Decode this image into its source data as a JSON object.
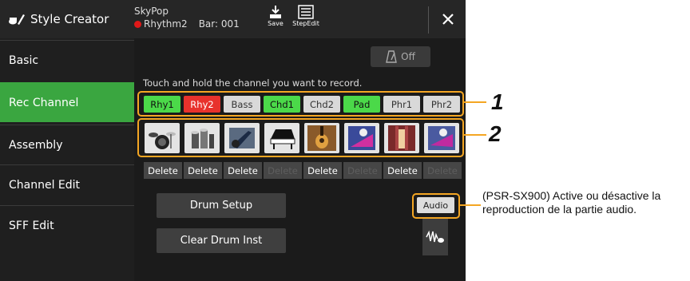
{
  "header": {
    "app_title": "Style Creator",
    "song_name": "SkyPop",
    "rec_channel": "Rhythm2",
    "bar_readout": "Bar: 001",
    "save_label": "Save",
    "stepedit_label": "StepEdit"
  },
  "sidebar": {
    "items": [
      {
        "label": "Basic",
        "active": false
      },
      {
        "label": "Rec Channel",
        "active": true
      },
      {
        "label": "Assembly",
        "active": false
      },
      {
        "label": "Channel Edit",
        "active": false
      },
      {
        "label": "SFF Edit",
        "active": false
      }
    ]
  },
  "main": {
    "metronome_label": "Off",
    "instruction": "Touch and hold the channel you want to record.",
    "channels": [
      {
        "label": "Rhy1",
        "state": "on",
        "icon": "drum-kit-icon",
        "delete": "Delete",
        "delete_enabled": true
      },
      {
        "label": "Rhy2",
        "state": "rec",
        "icon": "percussion-icon",
        "delete": "Delete",
        "delete_enabled": true
      },
      {
        "label": "Bass",
        "state": "off",
        "icon": "bass-guitar-icon",
        "delete": "Delete",
        "delete_enabled": true
      },
      {
        "label": "Chd1",
        "state": "on",
        "icon": "piano-icon",
        "delete": "Delete",
        "delete_enabled": false
      },
      {
        "label": "Chd2",
        "state": "off",
        "icon": "acoustic-guitar-icon",
        "delete": "Delete",
        "delete_enabled": true
      },
      {
        "label": "Pad",
        "state": "on",
        "icon": "synth-pad-icon",
        "delete": "Delete",
        "delete_enabled": false
      },
      {
        "label": "Phr1",
        "state": "off",
        "icon": "electric-guitar-icon",
        "delete": "Delete",
        "delete_enabled": true
      },
      {
        "label": "Phr2",
        "state": "off",
        "icon": "synth-phrase-icon",
        "delete": "Delete",
        "delete_enabled": false
      }
    ],
    "drum_setup_label": "Drum Setup",
    "clear_drum_label": "Clear Drum Inst",
    "audio_label": "Audio"
  },
  "callouts": {
    "one": "1",
    "two": "2",
    "audio_note": "(PSR-SX900) Active ou désactive la reproduction de la partie audio."
  },
  "colors": {
    "accent_green": "#3aa640",
    "channel_on": "#4bd949",
    "channel_rec": "#e8322c",
    "callout_orange": "#f4a623"
  }
}
